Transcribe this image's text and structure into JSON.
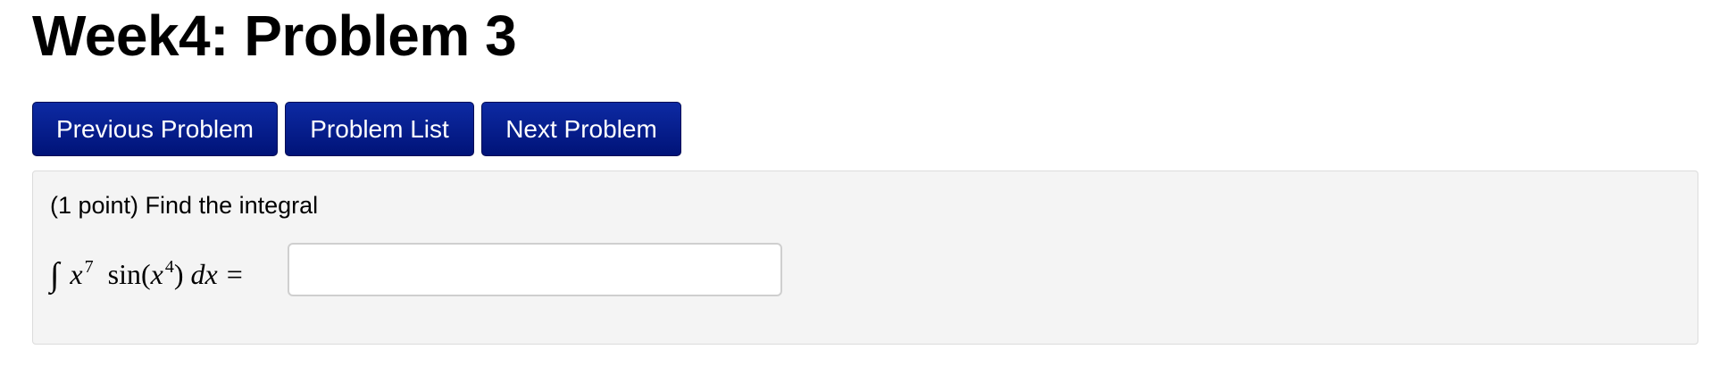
{
  "page": {
    "title": "Week4: Problem 3"
  },
  "nav": {
    "previous_label": "Previous Problem",
    "list_label": "Problem List",
    "next_label": "Next Problem"
  },
  "problem": {
    "statement": "(1 point) Find the integral",
    "math": {
      "integral_sign": "∫",
      "variable": "x",
      "power_outer": "7",
      "function": "sin",
      "power_inner": "4",
      "differential": "dx",
      "equals": "="
    },
    "answer": {
      "value": "",
      "placeholder": ""
    }
  },
  "colors": {
    "button_bg": "#001378",
    "panel_bg": "#f4f4f4"
  }
}
